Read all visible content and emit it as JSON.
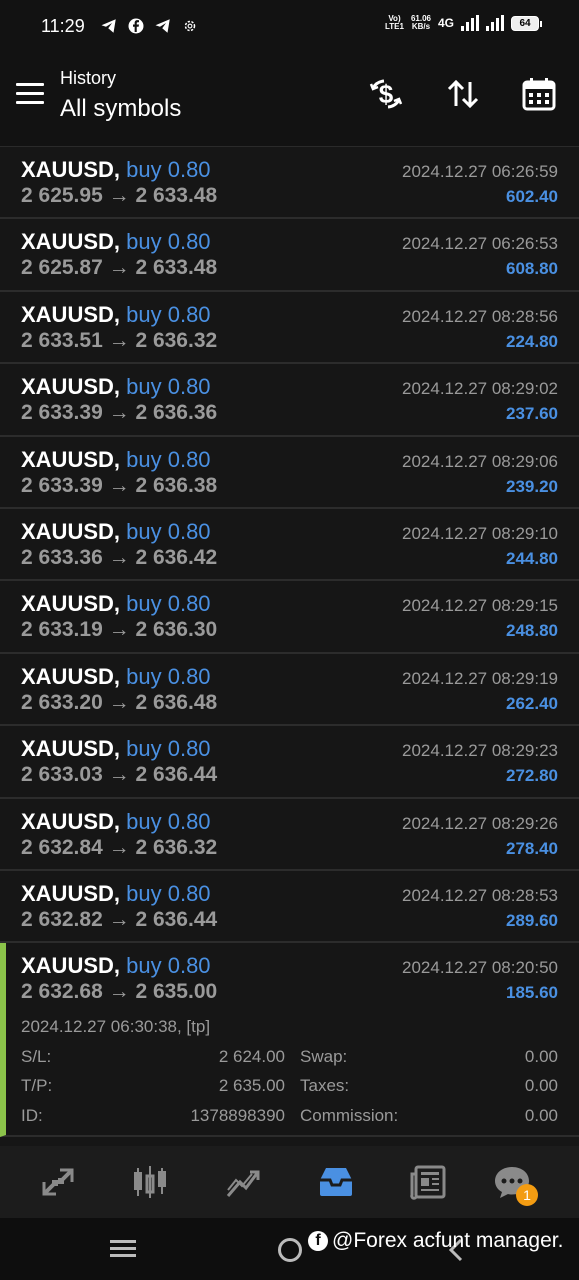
{
  "status_bar": {
    "time": "11:29",
    "network_type": "VoLTE1",
    "speed_value": "61.06",
    "speed_unit": "KB/s",
    "mobile_data": "4G",
    "battery": "64"
  },
  "header": {
    "subtitle": "History",
    "title": "All symbols",
    "icons": [
      "currency-filter-icon",
      "sort-icon",
      "calendar-icon"
    ]
  },
  "trades": [
    {
      "symbol": "XAUUSD,",
      "side": "buy 0.80",
      "open": "2 625.95",
      "arrow": "→",
      "close": "2 633.48",
      "date": "2024.12.27 06:26:59",
      "profit": "602.40"
    },
    {
      "symbol": "XAUUSD,",
      "side": "buy 0.80",
      "open": "2 625.87",
      "arrow": "→",
      "close": "2 633.48",
      "date": "2024.12.27 06:26:53",
      "profit": "608.80"
    },
    {
      "symbol": "XAUUSD,",
      "side": "buy 0.80",
      "open": "2 633.51",
      "arrow": "→",
      "close": "2 636.32",
      "date": "2024.12.27 08:28:56",
      "profit": "224.80"
    },
    {
      "symbol": "XAUUSD,",
      "side": "buy 0.80",
      "open": "2 633.39",
      "arrow": "→",
      "close": "2 636.36",
      "date": "2024.12.27 08:29:02",
      "profit": "237.60"
    },
    {
      "symbol": "XAUUSD,",
      "side": "buy 0.80",
      "open": "2 633.39",
      "arrow": "→",
      "close": "2 636.38",
      "date": "2024.12.27 08:29:06",
      "profit": "239.20"
    },
    {
      "symbol": "XAUUSD,",
      "side": "buy 0.80",
      "open": "2 633.36",
      "arrow": "→",
      "close": "2 636.42",
      "date": "2024.12.27 08:29:10",
      "profit": "244.80"
    },
    {
      "symbol": "XAUUSD,",
      "side": "buy 0.80",
      "open": "2 633.19",
      "arrow": "→",
      "close": "2 636.30",
      "date": "2024.12.27 08:29:15",
      "profit": "248.80"
    },
    {
      "symbol": "XAUUSD,",
      "side": "buy 0.80",
      "open": "2 633.20",
      "arrow": "→",
      "close": "2 636.48",
      "date": "2024.12.27 08:29:19",
      "profit": "262.40"
    },
    {
      "symbol": "XAUUSD,",
      "side": "buy 0.80",
      "open": "2 633.03",
      "arrow": "→",
      "close": "2 636.44",
      "date": "2024.12.27 08:29:23",
      "profit": "272.80"
    },
    {
      "symbol": "XAUUSD,",
      "side": "buy 0.80",
      "open": "2 632.84",
      "arrow": "→",
      "close": "2 636.32",
      "date": "2024.12.27 08:29:26",
      "profit": "278.40"
    },
    {
      "symbol": "XAUUSD,",
      "side": "buy 0.80",
      "open": "2 632.82",
      "arrow": "→",
      "close": "2 636.44",
      "date": "2024.12.27 08:28:53",
      "profit": "289.60"
    }
  ],
  "expanded_trade": {
    "symbol": "XAUUSD,",
    "side": "buy 0.80",
    "open": "2 632.68",
    "arrow": "→",
    "close": "2 635.00",
    "date": "2024.12.27 08:20:50",
    "profit": "185.60",
    "close_info": "2024.12.27 06:30:38, [tp]",
    "sl_label": "S/L:",
    "sl_value": "2 624.00",
    "tp_label": "T/P:",
    "tp_value": "2 635.00",
    "id_label": "ID:",
    "id_value": "1378898390",
    "swap_label": "Swap:",
    "swap_value": "0.00",
    "taxes_label": "Taxes:",
    "taxes_value": "0.00",
    "commission_label": "Commission:",
    "commission_value": "0.00",
    "accent_color": "#8bc34a"
  },
  "bottom_nav": {
    "items": [
      "quotes-icon",
      "chart-icon",
      "trade-icon",
      "history-icon",
      "news-icon",
      "chat-icon"
    ],
    "active": "history-icon",
    "chat_badge": "1",
    "active_color": "#4a90e2"
  },
  "system_nav": {
    "watermark": "@Forex acfunt manager."
  },
  "colors": {
    "profit": "#4a90e2",
    "side": "#4a90e2",
    "background": "#161616"
  }
}
